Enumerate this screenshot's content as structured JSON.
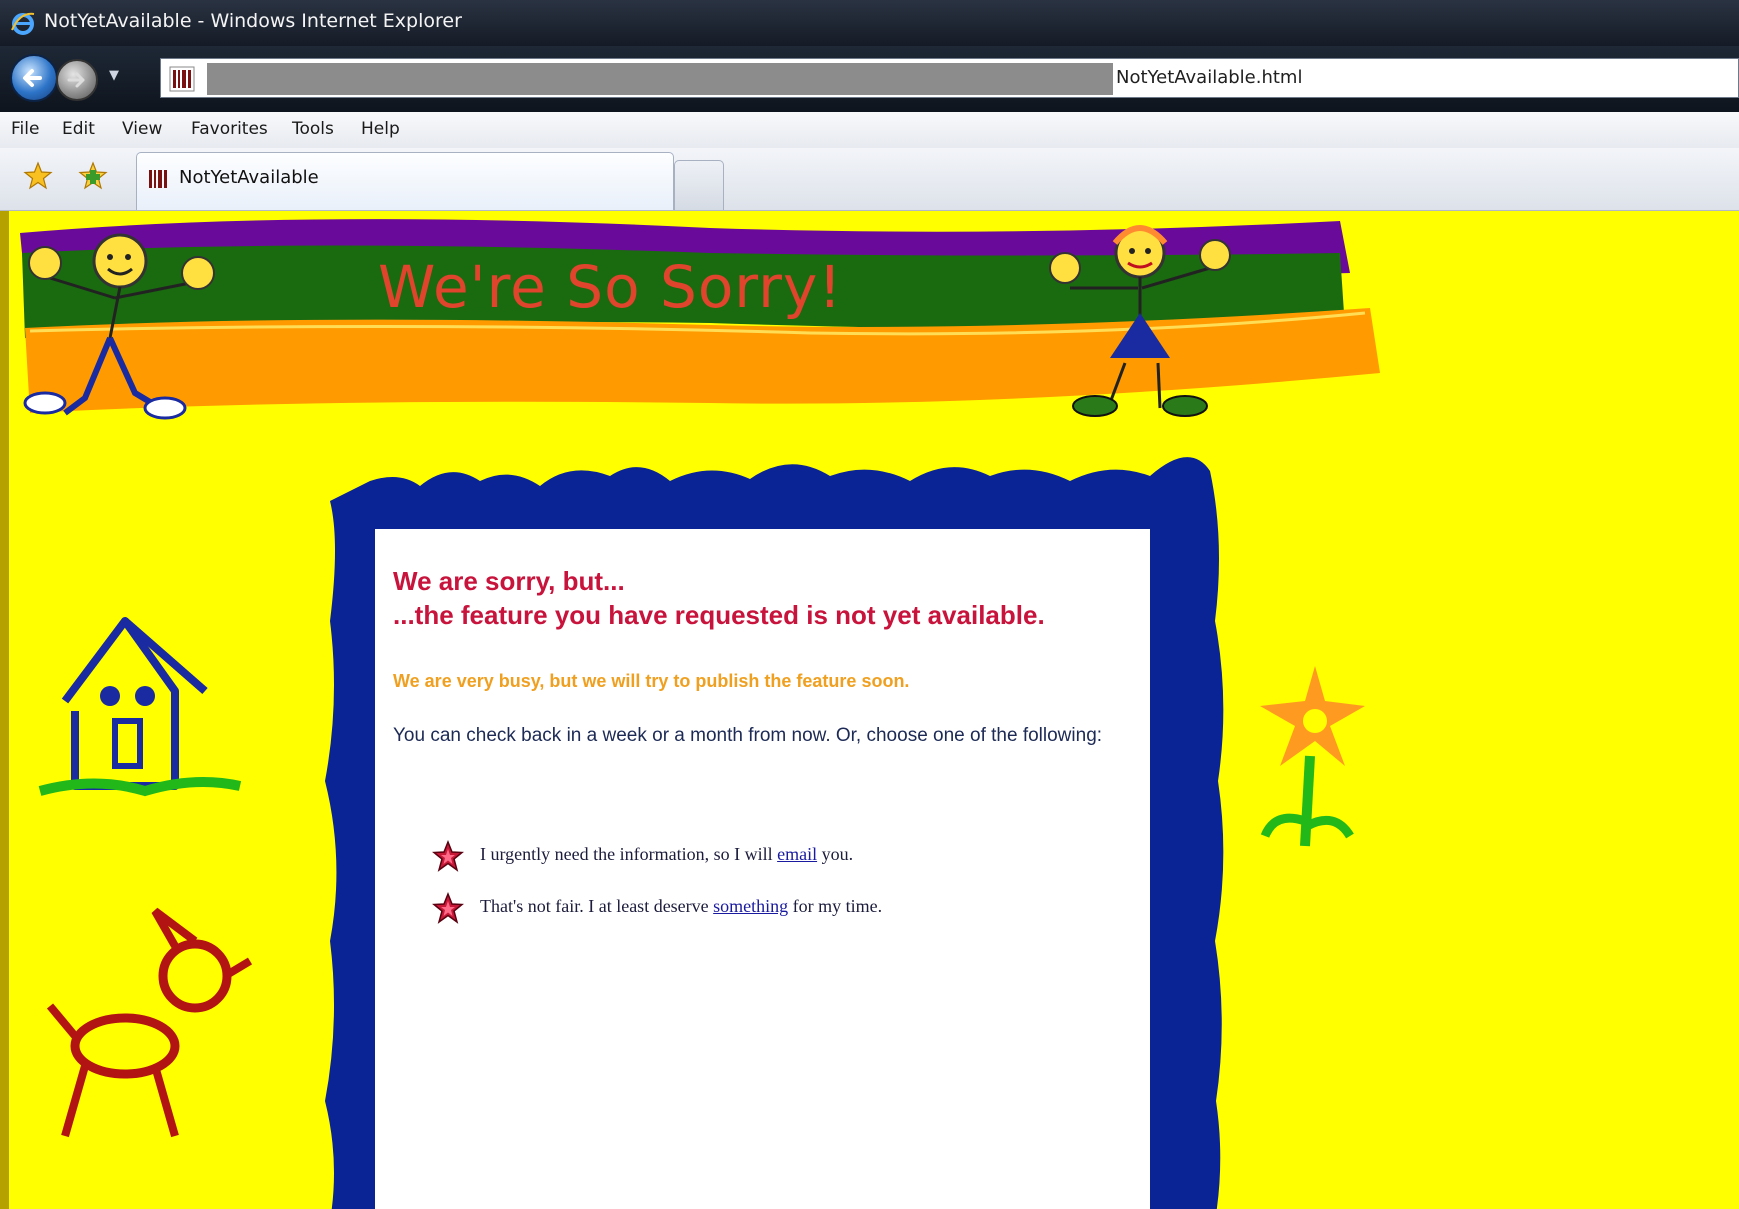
{
  "window": {
    "title": "NotYetAvailable - Windows Internet Explorer"
  },
  "address": {
    "url": "NotYetAvailable.html"
  },
  "menu": [
    "File",
    "Edit",
    "View",
    "Favorites",
    "Tools",
    "Help"
  ],
  "tab": {
    "label": "NotYetAvailable"
  },
  "banner": {
    "text": "We're So Sorry!"
  },
  "message": {
    "heading_line1": "We are sorry, but...",
    "heading_line2": "...the feature you have requested is not yet available.",
    "busy": "We are very busy, but we will try to publish the feature soon.",
    "check_back": "You can check back in a week or a month from now.  Or, choose one of the following:"
  },
  "options": [
    {
      "before": "I urgently need the information, so I will ",
      "link": "email",
      "after": " you."
    },
    {
      "before": "That's not fair.  I at least deserve ",
      "link": "something",
      "after": " for my time."
    }
  ],
  "colors": {
    "page_bg": "#ffff00",
    "heading": "#c8143c",
    "busy": "#f0a020",
    "frame_blue": "#0a2496",
    "banner_purple": "#6a0a9a",
    "banner_green": "#1a6a10",
    "banner_orange": "#ff9a00"
  },
  "icons": [
    "ie-logo-icon",
    "back-arrow-icon",
    "forward-arrow-icon",
    "site-icon",
    "favorites-star-icon",
    "add-favorites-icon",
    "star-bullet-icon"
  ]
}
